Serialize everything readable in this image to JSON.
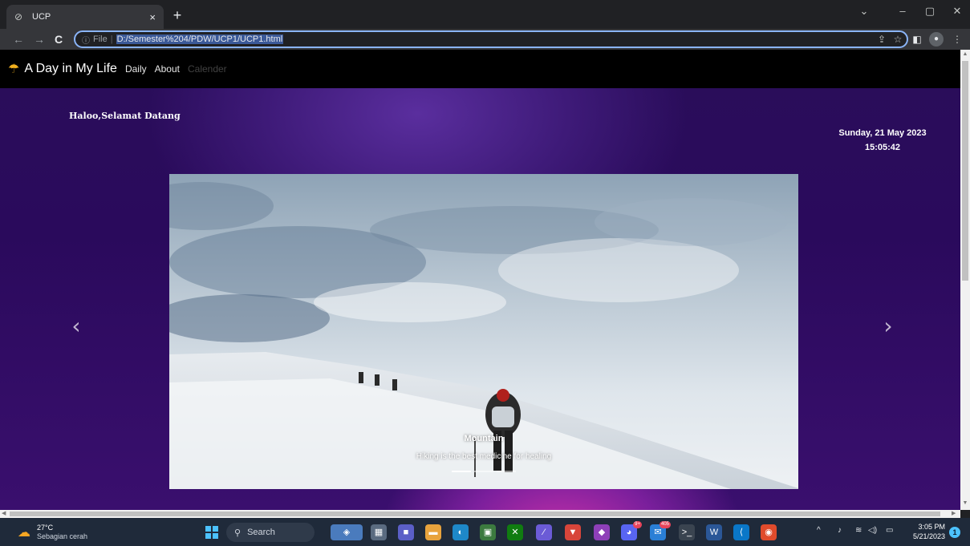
{
  "browser": {
    "tab_title": "UCP",
    "tab_close": "×",
    "new_tab": "+",
    "window_controls": [
      "⌄",
      "–",
      "▢",
      "✕"
    ],
    "nav": {
      "back": "←",
      "forward": "→",
      "reload": "C"
    },
    "address": {
      "info_icon": "ⓘ",
      "scheme_label": "File",
      "separator": "|",
      "url": "D:/Semester%204/PDW/UCP1/UCP1.html"
    },
    "toolbar_icons": [
      "share-icon",
      "star-icon",
      "sidepanel-icon",
      "profile-icon",
      "menu-icon"
    ]
  },
  "navbar": {
    "brand_icon": "☂",
    "brand": "A Day in My Life",
    "links": [
      {
        "label": "Daily",
        "state": "active"
      },
      {
        "label": "About",
        "state": "active"
      },
      {
        "label": "Calender",
        "state": "disabled"
      }
    ]
  },
  "greeting": "Haloo,Selamat Datang",
  "datetime": {
    "date": "Sunday, 21 May 2023",
    "time": "15:05:42"
  },
  "carousel": {
    "caption_title": "Mountain",
    "caption_text": "Hiking is the best medicine for healing",
    "prev": "‹",
    "next": "›",
    "indicators": 3,
    "active_indicator": 1
  },
  "taskbar": {
    "weather_temp": "27°C",
    "weather_desc": "Sebagian cerah",
    "search_label": "Search",
    "clock_time": "3:05 PM",
    "clock_date": "5/21/2023",
    "notification_count": "1",
    "discord_badge": "9+",
    "mail_badge": "405"
  },
  "colors": {
    "accent": "#8ab4f8",
    "navbar_bg": "#000000",
    "page_bg": "#2a0e5a",
    "brand_icon": "#f2b01e"
  }
}
